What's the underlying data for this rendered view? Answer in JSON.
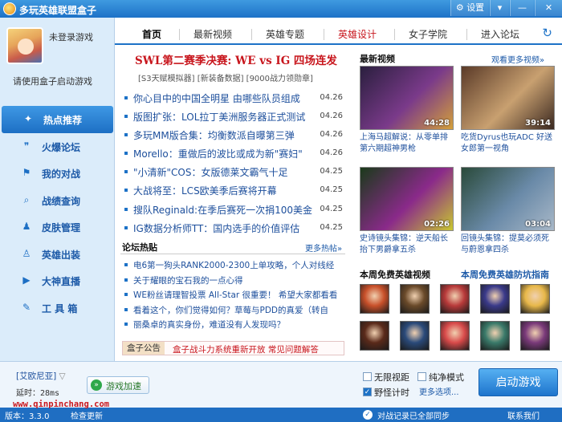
{
  "window": {
    "title": "多玩英雄联盟盒子",
    "settings_label": "设置",
    "settings_icon": "gear-icon",
    "menu_label": "▾",
    "minimize_label": "—",
    "close_label": "✕"
  },
  "profile": {
    "status": "未登录游戏",
    "hint": "请使用盒子启动游戏"
  },
  "sidebar": {
    "items": [
      {
        "label": "热点推荐",
        "icon": "fire-icon",
        "glyph": "✦",
        "active": true
      },
      {
        "label": "火爆论坛",
        "icon": "chat-bubble-icon",
        "glyph": "❞"
      },
      {
        "label": "我的对战",
        "icon": "flag-icon",
        "glyph": "⚑"
      },
      {
        "label": "战绩查询",
        "icon": "search-icon",
        "glyph": "⌕"
      },
      {
        "label": "皮肤管理",
        "icon": "shirt-icon",
        "glyph": "♟"
      },
      {
        "label": "英雄出装",
        "icon": "figure-icon",
        "glyph": "♙"
      },
      {
        "label": "大神直播",
        "icon": "play-icon",
        "glyph": "▶"
      },
      {
        "label": "工 具 箱",
        "icon": "wrench-icon",
        "glyph": "✎"
      }
    ]
  },
  "tabs": [
    {
      "label": "首页",
      "active": true
    },
    {
      "label": "最新视频"
    },
    {
      "label": "英雄专题"
    },
    {
      "label": "英雄设计",
      "red": true
    },
    {
      "label": "女子学院"
    },
    {
      "label": "进入论坛"
    }
  ],
  "headline": "SWL第二赛季决赛: WE vs IG 四场连发",
  "sublinks": "[S3天赋模拟器] [新装备数据] [9000战力领勋章]",
  "news": [
    {
      "title": "你心目中的中国全明星 由哪些队员组成",
      "date": "04.26"
    },
    {
      "title": "版图扩张：LOL拉丁美洲服务器正式测试",
      "date": "04.26"
    },
    {
      "title": "多玩MM版合集：均衡数派自曝第三弹",
      "date": "04.26"
    },
    {
      "title": "Morello：重做后的波比或成为新\"赛妇\"",
      "date": "04.26"
    },
    {
      "title": "\"小清新\"COS：女版德莱文霸气十足",
      "date": "04.25"
    },
    {
      "title": "大战将至：LCS欧美季后赛将开幕",
      "date": "04.25"
    },
    {
      "title": "搜队Reginald:在季后赛死一次捐100美金",
      "date": "04.25"
    },
    {
      "title": "IG数据分析师TT：国内选手的价值评估",
      "date": "04.25"
    }
  ],
  "forum": {
    "title": "论坛热贴",
    "more": "更多热帖»",
    "items": [
      "电6第一狗头RANK2000-2300上单攻略，个人对线经",
      "关于耀眼的宝石我的一点心得",
      "WE粉丝请理智投票 All-Star 很重要！ 希望大家都看看",
      "看着这个，你们觉得如何？草莓与PDD的真爱（转自",
      "丽桑卓的真实身份，难道没有人发现吗？"
    ]
  },
  "notice": {
    "label": "盒子公告",
    "text": "盒子战斗力系统重新开放 常见问题解答"
  },
  "videos": {
    "title": "最新视频",
    "more": "观看更多视频»",
    "items": [
      {
        "duration": "44:28",
        "caption": "上海马超解说：从零单排第六期超神男枪",
        "colors": [
          "#2a1f3e",
          "#7a3a8a",
          "#d4a03a"
        ]
      },
      {
        "duration": "39:14",
        "caption": "吃货Dyrus也玩ADC 好送女郎第一视角",
        "colors": [
          "#5a3a28",
          "#c8a070",
          "#3a2820"
        ]
      },
      {
        "duration": "02:26",
        "caption": "史诗镜头集锦：逆天船长抬下男爵拿五杀",
        "colors": [
          "#1a3a1a",
          "#8a2a8a",
          "#c8c830"
        ]
      },
      {
        "duration": "03:04",
        "caption": "回镜头集锦：提莫必须死与蔚恩拿四杀",
        "colors": [
          "#2a4a3a",
          "#6a8aa8",
          "#a8b8c8"
        ]
      }
    ]
  },
  "heroes": {
    "free_title": "本周免费英雄视频",
    "guide_title": "本周免费英雄防坑指南",
    "colors": [
      "#c8502a",
      "#6a4a2a",
      "#b83a3a",
      "#3a3a8a",
      "#e8b84a",
      "#5a2a1a",
      "#2a4a7a",
      "#d84a4a",
      "#3a7a6a",
      "#7a3a7a"
    ]
  },
  "bottom": {
    "region": "[艾欧尼亚]",
    "latency_label": "延时：",
    "latency_value": "28ms",
    "accel_label": "游戏加速",
    "options": [
      {
        "label": "无限视距",
        "checked": false
      },
      {
        "label": "纯净模式",
        "checked": false
      },
      {
        "label": "野怪计时",
        "checked": true
      }
    ],
    "more_options": "更多选项...",
    "launch_label": "启动游戏"
  },
  "status": {
    "version": "版本：3.3.0",
    "update": "检查更新",
    "sync": "对战记录已全部同步",
    "contact": "联系我们",
    "watermark": "www.qinpinchang.com"
  }
}
